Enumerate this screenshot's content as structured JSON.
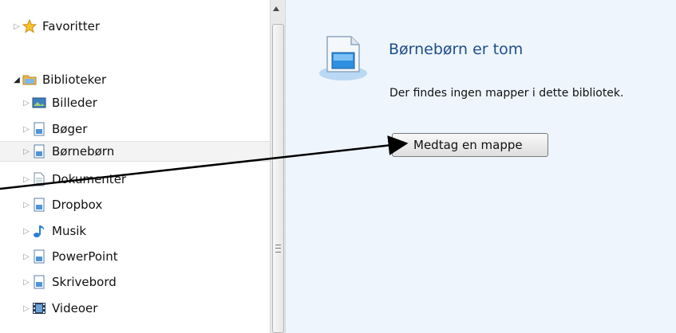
{
  "nav": {
    "items": [
      {
        "label": "Favoritter",
        "icon": "favorites-star-icon",
        "expanded": false,
        "selected": false
      },
      {
        "label": "Biblioteker",
        "icon": "libraries-folder-icon",
        "expanded": true,
        "selected": false
      },
      {
        "label": "Billeder",
        "icon": "pictures-library-icon",
        "expanded": false,
        "selected": false
      },
      {
        "label": "Bøger",
        "icon": "library-icon",
        "expanded": false,
        "selected": false
      },
      {
        "label": "Børnebørn",
        "icon": "library-icon",
        "expanded": false,
        "selected": true
      },
      {
        "label": "Dokumenter",
        "icon": "documents-library-icon",
        "expanded": false,
        "selected": false
      },
      {
        "label": "Dropbox",
        "icon": "library-icon",
        "expanded": false,
        "selected": false
      },
      {
        "label": "Musik",
        "icon": "music-library-icon",
        "expanded": false,
        "selected": false
      },
      {
        "label": "PowerPoint",
        "icon": "library-icon",
        "expanded": false,
        "selected": false
      },
      {
        "label": "Skrivebord",
        "icon": "library-icon",
        "expanded": false,
        "selected": false
      },
      {
        "label": "Videoer",
        "icon": "videos-library-icon",
        "expanded": false,
        "selected": false
      }
    ]
  },
  "main": {
    "title": "Børnebørn er tom",
    "description": "Der findes ingen mapper i dette bibliotek.",
    "include_button": "Medtag en mappe"
  },
  "colors": {
    "title": "#1f4f8a",
    "content_background": "#eef5fc",
    "selection_background": "#f3f3f3"
  }
}
